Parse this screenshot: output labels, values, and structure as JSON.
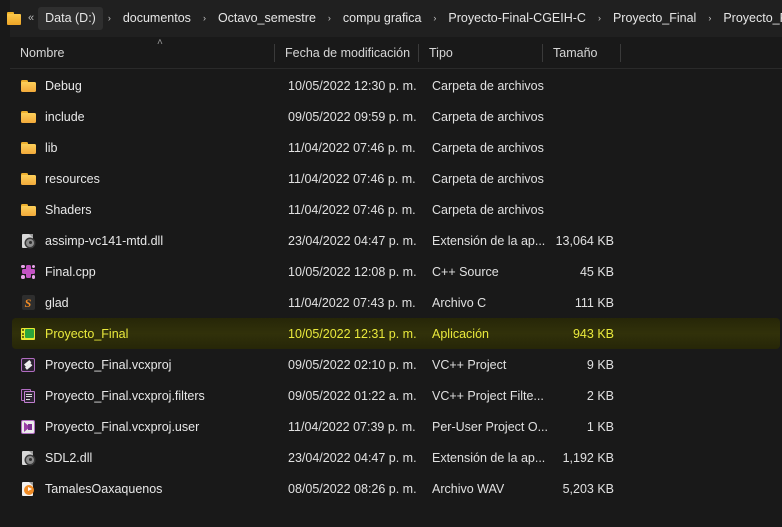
{
  "window": {
    "background_color": "#191919",
    "theme": "dark"
  },
  "addressbar": {
    "folder_icon": "folder-icon",
    "overflow_label": "«",
    "crumbs": [
      {
        "label": "Data (D:)",
        "active": true
      },
      {
        "label": "documentos",
        "active": false
      },
      {
        "label": "Octavo_semestre",
        "active": false
      },
      {
        "label": "compu grafica",
        "active": false
      },
      {
        "label": "Proyecto-Final-CGEIH-C",
        "active": false
      },
      {
        "label": "Proyecto_Final",
        "active": false
      },
      {
        "label": "Proyecto_Final",
        "active": false
      }
    ],
    "separator": "›"
  },
  "columns": {
    "name": "Nombre",
    "date": "Fecha de modificación",
    "type": "Tipo",
    "size": "Tamaño",
    "sort_glyph": "˄",
    "sort_column": "Nombre",
    "sort_direction": "ascending"
  },
  "selection": {
    "selected_row": "Proyecto_Final",
    "highlight_background": "#31310a",
    "highlight_text_color": "#e9e93c"
  },
  "files": [
    {
      "name": "Debug",
      "date": "10/05/2022 12:30 p. m.",
      "type": "Carpeta de archivos",
      "size": "",
      "icon": "folder-icon",
      "selected": false
    },
    {
      "name": "include",
      "date": "09/05/2022 09:59 p. m.",
      "type": "Carpeta de archivos",
      "size": "",
      "icon": "folder-icon",
      "selected": false
    },
    {
      "name": "lib",
      "date": "11/04/2022 07:46 p. m.",
      "type": "Carpeta de archivos",
      "size": "",
      "icon": "folder-icon",
      "selected": false
    },
    {
      "name": "resources",
      "date": "11/04/2022 07:46 p. m.",
      "type": "Carpeta de archivos",
      "size": "",
      "icon": "folder-icon",
      "selected": false
    },
    {
      "name": "Shaders",
      "date": "11/04/2022 07:46 p. m.",
      "type": "Carpeta de archivos",
      "size": "",
      "icon": "folder-icon",
      "selected": false
    },
    {
      "name": "assimp-vc141-mtd.dll",
      "date": "23/04/2022 04:47 p. m.",
      "type": "Extensión de la ap...",
      "size": "13,064 KB",
      "icon": "dll-icon",
      "selected": false
    },
    {
      "name": "Final.cpp",
      "date": "10/05/2022 12:08 p. m.",
      "type": "C++ Source",
      "size": "45 KB",
      "icon": "cpp-source-icon",
      "selected": false
    },
    {
      "name": "glad",
      "date": "11/04/2022 07:43 p. m.",
      "type": "Archivo C",
      "size": "111 KB",
      "icon": "sublime-text-icon",
      "selected": false
    },
    {
      "name": "Proyecto_Final",
      "date": "10/05/2022 12:31 p. m.",
      "type": "Aplicación",
      "size": "943 KB",
      "icon": "application-icon",
      "selected": true
    },
    {
      "name": "Proyecto_Final.vcxproj",
      "date": "09/05/2022 02:10 p. m.",
      "type": "VC++ Project",
      "size": "9 KB",
      "icon": "vcxproj-icon",
      "selected": false
    },
    {
      "name": "Proyecto_Final.vcxproj.filters",
      "date": "09/05/2022 01:22 a. m.",
      "type": "VC++ Project Filte...",
      "size": "2 KB",
      "icon": "vcxproj-filters-icon",
      "selected": false
    },
    {
      "name": "Proyecto_Final.vcxproj.user",
      "date": "11/04/2022 07:39 p. m.",
      "type": "Per-User Project O...",
      "size": "1 KB",
      "icon": "vcxproj-user-icon",
      "selected": false
    },
    {
      "name": "SDL2.dll",
      "date": "23/04/2022 04:47 p. m.",
      "type": "Extensión de la ap...",
      "size": "1,192 KB",
      "icon": "dll-icon",
      "selected": false
    },
    {
      "name": "TamalesOaxaquenos",
      "date": "08/05/2022 08:26 p. m.",
      "type": "Archivo WAV",
      "size": "5,203 KB",
      "icon": "wav-audio-icon",
      "selected": false
    }
  ]
}
